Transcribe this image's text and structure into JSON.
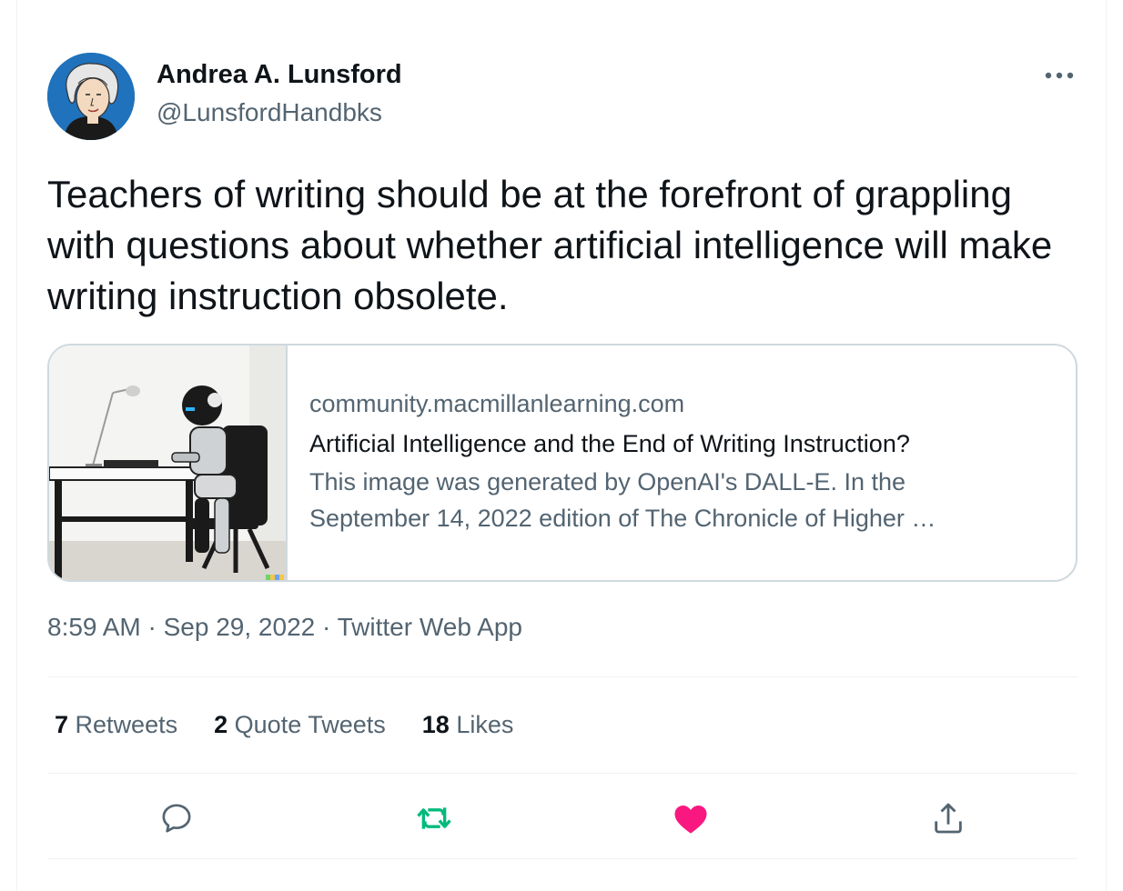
{
  "author": {
    "name": "Andrea A. Lunsford",
    "handle": "@LunsfordHandbks"
  },
  "tweet": {
    "text": "Teachers of writing should be at the forefront of grappling with questions about whether artificial intelligence will make writing instruction obsolete."
  },
  "card": {
    "domain": "community.macmillanlearning.com",
    "title": "Artificial Intelligence and the End of Writing Instruction?",
    "description": " This image was generated by OpenAI's DALL-E.   In the\nSeptember 14, 2022 edition of The Chronicle of Higher …"
  },
  "meta": {
    "time": "8:59 AM",
    "separator": " · ",
    "date": "Sep 29, 2022",
    "source": "Twitter Web App"
  },
  "stats": {
    "retweets": {
      "count": "7",
      "label": "Retweets"
    },
    "quotes": {
      "count": "2",
      "label": "Quote Tweets"
    },
    "likes": {
      "count": "18",
      "label": "Likes"
    }
  },
  "icons": {
    "more": "more-icon",
    "reply": "reply-icon",
    "retweet": "retweet-icon",
    "like": "like-icon",
    "share": "share-icon"
  },
  "colors": {
    "retweet": "#00ba7c",
    "like": "#f91880",
    "secondary_text": "#536471",
    "border": "#cfd9de"
  }
}
